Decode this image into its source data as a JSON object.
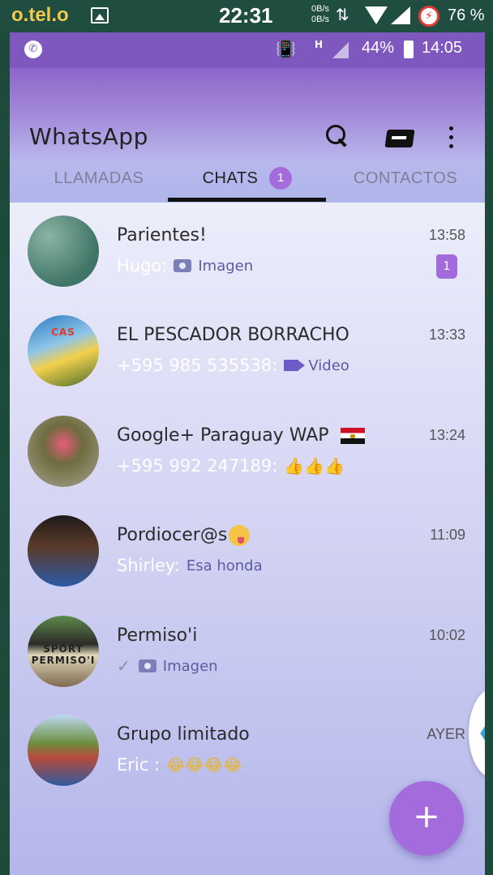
{
  "outer_status": {
    "carrier": "o.tel.o",
    "time": "22:31",
    "netspeed_up": "0B/s",
    "netspeed_down": "0B/s",
    "arrows": "⇅",
    "battery": "76 %"
  },
  "inner_status": {
    "net_type": "H",
    "battery": "44%",
    "clock": "14:05"
  },
  "app": {
    "title": "WhatsApp"
  },
  "tabs": [
    {
      "label": "LLAMADAS"
    },
    {
      "label": "CHATS",
      "badge": "1"
    },
    {
      "label": "CONTACTOS"
    }
  ],
  "chats": [
    {
      "name": "Parientes!",
      "time": "13:58",
      "sender": "Hugo:",
      "message": "Imagen",
      "unread": "1",
      "avatar_label": ""
    },
    {
      "name": "EL PESCADOR BORRACHO",
      "time": "13:33",
      "sender": "+595 985 535538:",
      "message": "Video",
      "avatar_label": "CAS"
    },
    {
      "name": "Google+ Paraguay WAP",
      "time": "13:24",
      "sender": "+595 992 247189:",
      "message": "👍👍👍",
      "avatar_label": ""
    },
    {
      "name": "Pordiocer@s",
      "time": "11:09",
      "sender": "Shirley:",
      "message": "Esa honda",
      "avatar_label": ""
    },
    {
      "name": "Permiso'i",
      "time": "10:02",
      "check": "✓",
      "message": "Imagen",
      "avatar_label": "SPORT PERMISO'I"
    },
    {
      "name": "Grupo limitado",
      "time": "AYER",
      "sender": "Eric :",
      "message": "😂😂😂😂",
      "avatar_label": ""
    }
  ],
  "fab": {
    "label": "+"
  },
  "side_handle": {
    "label": "❮"
  },
  "colors": {
    "accent": "#a36bdc",
    "appbar": "#7e58bf",
    "outer_status": "#1f4d3f"
  }
}
